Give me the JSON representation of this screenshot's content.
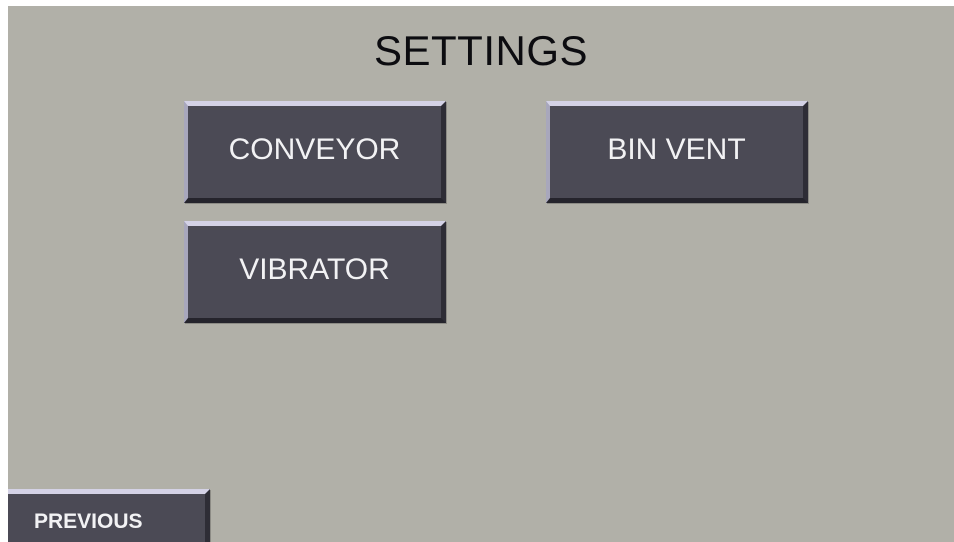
{
  "screen": {
    "title": "SETTINGS",
    "background_color": "#b1b0a8",
    "button_color": "#4b4a55"
  },
  "buttons": {
    "conveyor": "CONVEYOR",
    "bin_vent": "BIN VENT",
    "vibrator": "VIBRATOR",
    "previous": "PREVIOUS"
  }
}
